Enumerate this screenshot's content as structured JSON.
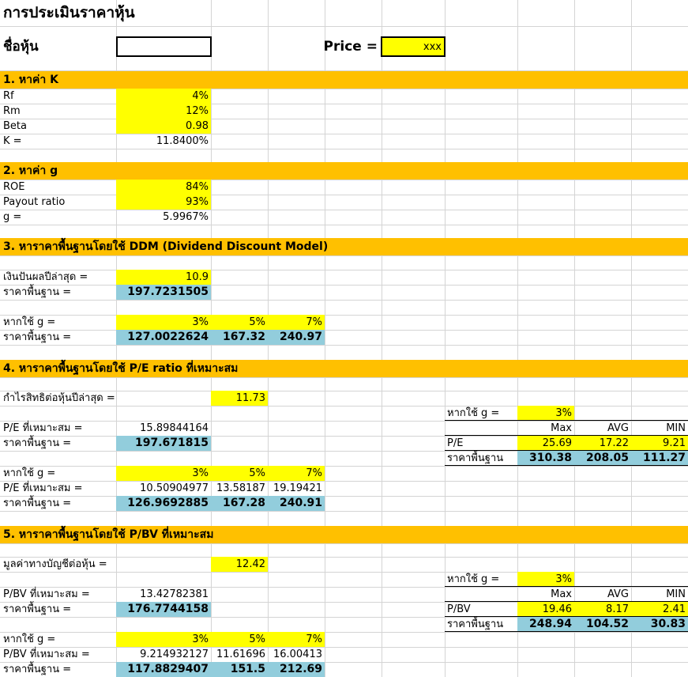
{
  "title": "การประเมินราคาหุ้น",
  "stock_label": "ชื่อหุ้น",
  "price_label": "Price =",
  "price_value": "xxx",
  "s1": {
    "header": "1. หาค่า K",
    "rf_label": "Rf",
    "rf": "4%",
    "rm_label": "Rm",
    "rm": "12%",
    "beta_label": "Beta",
    "beta": "0.98",
    "k_label": "K =",
    "k": "11.8400%"
  },
  "s2": {
    "header": "2. หาค่า g",
    "roe_label": "ROE",
    "roe": "84%",
    "payout_label": "Payout ratio",
    "payout": "93%",
    "g_label": "g =",
    "g": "5.9967%"
  },
  "s3": {
    "header": "3. หาราคาพื้นฐานโดยใช้ DDM (Dividend Discount Model)",
    "div_label": "เงินปันผลปีล่าสุด =",
    "div": "10.9",
    "base_label": "ราคาพื้นฐาน =",
    "base": "197.7231505",
    "ifg_label": "หากใช้ g =",
    "g1": "3%",
    "g2": "5%",
    "g3": "7%",
    "base2_label": "ราคาพื้นฐาน =",
    "b1": "127.0022624",
    "b2": "167.32",
    "b3": "240.97"
  },
  "s4": {
    "header": "4. หาราคาพื้นฐานโดยใช้ P/E ratio ที่เหมาะสม",
    "eps_label": "กำไรสิทธิต่อหุ้นปีล่าสุด =",
    "eps": "11.73",
    "pe_label": "P/E ที่เหมาะสม =",
    "pe": "15.89844164",
    "base_label": "ราคาพื้นฐาน =",
    "base": "197.671815",
    "ifg_label": "หากใช้ g =",
    "g1": "3%",
    "g2": "5%",
    "g3": "7%",
    "pe2_label": "P/E ที่เหมาะสม =",
    "pe1": "10.50904977",
    "pe2": "13.58187",
    "pe3": "19.19421",
    "base2_label": "ราคาพื้นฐาน =",
    "b1": "126.9692885",
    "b2": "167.28",
    "b3": "240.91",
    "side": {
      "ifg_label": "หากใช้ g =",
      "g": "3%",
      "max": "Max",
      "avg": "AVG",
      "min": "MIN",
      "ratio_label": "P/E",
      "r_max": "25.69",
      "r_avg": "17.22",
      "r_min": "9.21",
      "price_label": "ราคาพื้นฐาน",
      "p_max": "310.38",
      "p_avg": "208.05",
      "p_min": "111.27"
    }
  },
  "s5": {
    "header": "5. หาราคาพื้นฐานโดยใช้ P/BV ที่เหมาะสม",
    "bv_label": "มูลค่าทางบัญชีต่อหุ้น =",
    "bv": "12.42",
    "pbv_label": "P/BV ที่เหมาะสม =",
    "pbv": "13.42782381",
    "base_label": "ราคาพื้นฐาน =",
    "base": "176.7744158",
    "ifg_label": "หากใช้ g =",
    "g1": "3%",
    "g2": "5%",
    "g3": "7%",
    "pbv2_label": "P/BV ที่เหมาะสม =",
    "pbv1": "9.214932127",
    "pbv2_v": "11.61696",
    "pbv3": "16.00413",
    "base2_label": "ราคาพื้นฐาน =",
    "b1": "117.8829407",
    "b2": "151.5",
    "b3": "212.69",
    "side": {
      "ifg_label": "หากใช้ g =",
      "g": "3%",
      "max": "Max",
      "avg": "AVG",
      "min": "MIN",
      "ratio_label": "P/BV",
      "r_max": "19.46",
      "r_avg": "8.17",
      "r_min": "2.41",
      "price_label": "ราคาพื้นฐาน",
      "p_max": "248.94",
      "p_avg": "104.52",
      "p_min": "30.83"
    }
  }
}
